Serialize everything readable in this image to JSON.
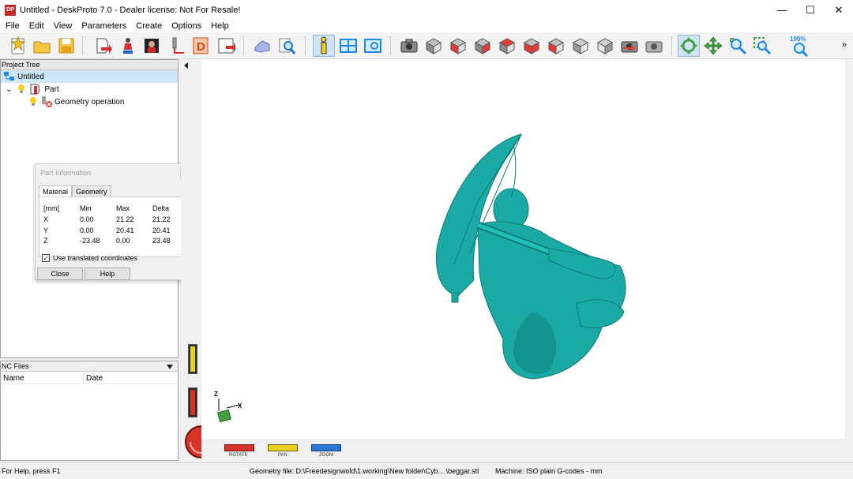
{
  "window": {
    "title": "Untitled - DeskProto 7.0 - Dealer license: Not For Resale!",
    "logo_text": "DP",
    "minimize": "—",
    "maximize": "☐",
    "close": "✕"
  },
  "menu": [
    "File",
    "Edit",
    "View",
    "Parameters",
    "Create",
    "Options",
    "Help"
  ],
  "toolbar": {
    "zoom_level": "100%",
    "overflow": "»"
  },
  "project_tree": {
    "header": "Project Tree",
    "items": [
      {
        "label": "Untitled",
        "selected": true
      },
      {
        "label": "Part",
        "expander": "⌄"
      },
      {
        "label": "Geometry operation"
      }
    ]
  },
  "nc_files": {
    "header": "NC Files",
    "columns": [
      "Name",
      "Date"
    ]
  },
  "part_info": {
    "title": "Part Information",
    "tabs": [
      "Material",
      "Geometry"
    ],
    "active_tab": "Material",
    "headers": [
      "[mm]",
      "Min",
      "Max",
      "Delta"
    ],
    "rows": [
      [
        "X",
        "0.00",
        "21.22",
        "21.22"
      ],
      [
        "Y",
        "0.00",
        "20.41",
        "20.41"
      ],
      [
        "Z",
        "-23.48",
        "0.00",
        "23.48"
      ]
    ],
    "checkbox_label": "Use translated coordinates",
    "checkbox_checked": true,
    "close_button": "Close",
    "help_button": "Help"
  },
  "viewport": {
    "axis_z": "Z",
    "axis_x": "X",
    "dials": [
      "ROTATE",
      "PAN",
      "ZOOM"
    ]
  },
  "status": {
    "help": "For Help, press F1",
    "geometry_file": "Geometry file: D:\\Freedesignwold\\1.working\\New folder\\Cyb... \\beggar.stl",
    "machine": "Machine: ISO plain G-codes - mm"
  },
  "colors": {
    "model": "#1aa9a4",
    "model_dark": "#0e7b77",
    "selection": "#cde6fa",
    "rotate_dial": "#d9342a",
    "pan_dial": "#e8d21c",
    "zoom_dial": "#2b79d6"
  }
}
